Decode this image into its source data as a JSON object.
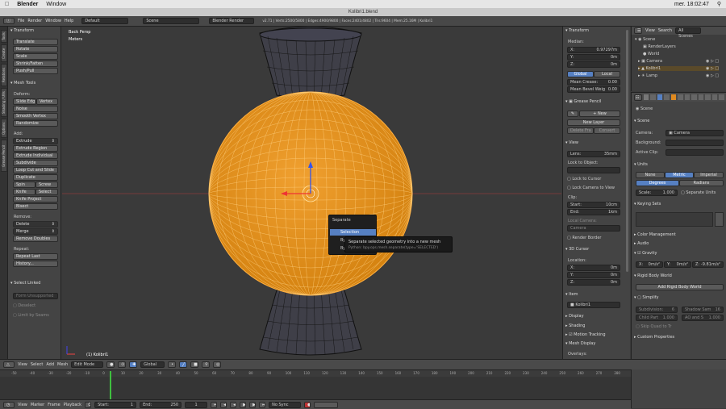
{
  "mac_menu": {
    "apple": "",
    "app": "Blender",
    "window": "Window",
    "clock": "mer. 18:02:47"
  },
  "window_title": "Kolibri1.blend",
  "top": {
    "menus": [
      "File",
      "Render",
      "Window",
      "Help"
    ],
    "layout": "Default",
    "scene": "Scene",
    "engine": "Blender Render",
    "stats": "v2.71 | Verts:2500/5800 | Edges:4900/9800 | Faces:2401/4802 | Tris:9604 | Mem:25.16M | Kolibri1"
  },
  "left_tabs": [
    "Tools",
    "Create",
    "Relations",
    "Shading / UVs",
    "Options",
    "Grease Pencil"
  ],
  "tools": {
    "transform_header": "Transform",
    "transform": [
      "Translate",
      "Rotate",
      "Scale",
      "Shrink/Fatten",
      "Push/Pull"
    ],
    "mesh_tools_header": "Mesh Tools",
    "deform_label": "Deform:",
    "slide_edge": "Slide Edg",
    "vertex": "Vertex",
    "deform": [
      "Noise",
      "Smooth Vertex",
      "Randomize"
    ],
    "add_label": "Add:",
    "extrude": "Extrude",
    "add": [
      "Extrude Region",
      "Extrude Individual",
      "Subdivide",
      "Loop Cut and Slide",
      "Duplicate"
    ],
    "spin": "Spin",
    "screw": "Screw",
    "knife": "Knife",
    "select": "Select",
    "add2": [
      "Knife Project",
      "Bisect"
    ],
    "remove_label": "Remove:",
    "delete": "Delete",
    "merge": "Merge",
    "remove_doubles": "Remove Doubles",
    "repeat_label": "Repeat:",
    "repeat_last": "Repeat Last",
    "history": "History...",
    "select_linked_header": "Select Linked",
    "select_linked_field": "Form Unsupported",
    "deselect": "Deselect",
    "limit_by_seams": "Limit by Seams"
  },
  "viewport": {
    "view_name": "Back Persp",
    "units": "Meters",
    "object_label": "(1) Kolibri1",
    "popup": {
      "title": "Separate",
      "selected": "Selection",
      "by1": "By",
      "by2": "By",
      "tooltip": "Separate selected geometry into a new mesh",
      "python": "Python: bpy.ops.mesh.separate(type='SELECTED')"
    }
  },
  "npanel": {
    "transform_header": "Transform",
    "median_label": "Median:",
    "x": "X:",
    "x_val": "0.97297m",
    "y": "Y:",
    "y_val": "0m",
    "z": "Z:",
    "z_val": "0m",
    "global": "Global",
    "local": "Local",
    "mean_crease": "Mean Crease:",
    "mean_crease_val": "0.00",
    "mean_bevel": "Mean Bevel Weig",
    "mean_bevel_val": "0.00",
    "grease_header": "Grease Pencil",
    "new": "New",
    "new_layer": "New Layer",
    "delete_fra": "Delete Fra",
    "convert": "Convert",
    "view_header": "View",
    "lens": "Lens:",
    "lens_val": "35mm",
    "lock_to_object": "Lock to Object:",
    "lock_to_cursor": "Lock to Cursor",
    "lock_camera_to_view": "Lock Camera to View",
    "clip_label": "Clip:",
    "start": "Start:",
    "start_val": "10cm",
    "end": "End:",
    "end_val": "1km",
    "local_camera": "Local Camera:",
    "camera": "Camera",
    "render_border": "Render Border",
    "cursor_header": "3D Cursor",
    "location": "Location:",
    "cx": "X:",
    "cx_val": "0m",
    "cy": "Y:",
    "cy_val": "0m",
    "cz": "Z:",
    "cz_val": "0m",
    "item_header": "Item",
    "item_val": "Kolibri1",
    "display": "Display",
    "shading": "Shading",
    "motion_tracking": "Motion Tracking",
    "mesh_display": "Mesh Display",
    "overlays": "Overlays:"
  },
  "outliner": {
    "view": "View",
    "search": "Search",
    "all_scenes": "All Scenes",
    "items": [
      "Scene",
      "RenderLayers",
      "World",
      "Camera",
      "Kolibri1",
      "Lamp"
    ]
  },
  "properties": {
    "scene_label": "Scene",
    "scene_header": "Scene",
    "camera_label": "Camera:",
    "camera_val": "Camera",
    "background": "Background:",
    "active_clip": "Active Clip:",
    "units_header": "Units",
    "none": "None",
    "metric": "Metric",
    "imperial": "Imperial",
    "degrees": "Degrees",
    "radians": "Radians",
    "scale": "Scale:",
    "scale_val": "1.000",
    "separate_units": "Separate Units",
    "keying_header": "Keying Sets",
    "color_mgmt": "Color Management",
    "audio": "Audio",
    "gravity": "Gravity",
    "gx": "X:",
    "gx_val": "0m/s²",
    "gy": "Y:",
    "gy_val": "0m/s²",
    "gz": "Z:",
    "gz_val": "-9.81m/s²",
    "rigid_header": "Rigid Body World",
    "add_rigid": "Add Rigid Body World",
    "simplify": "Simplify",
    "subdivision": "Subdivision:",
    "subdivision_val": "6",
    "shadow_samples": "Shadow Sam",
    "shadow_samples_val": "16",
    "child_part": "Child Part",
    "child_part_val": "1.000",
    "ao_and_s": "AO and S",
    "ao_and_s_val": "1.000",
    "skip_quad": "Skip Quad to Tr",
    "custom_props": "Custom Properties"
  },
  "vp_header": {
    "menus": [
      "View",
      "Select",
      "Add",
      "Mesh"
    ],
    "mode": "Edit Mode",
    "orientation": "Global"
  },
  "timeline": {
    "ticks": [
      "-50",
      "-40",
      "-30",
      "-20",
      "-10",
      "0",
      "10",
      "20",
      "30",
      "40",
      "50",
      "60",
      "70",
      "80",
      "90",
      "100",
      "110",
      "120",
      "130",
      "140",
      "150",
      "160",
      "170",
      "180",
      "190",
      "200",
      "210",
      "220",
      "230",
      "240",
      "250",
      "260",
      "270",
      "280"
    ],
    "menus": [
      "View",
      "Marker",
      "Frame",
      "Playback"
    ],
    "start_label": "Start:",
    "start_val": "1",
    "end_label": "End:",
    "end_val": "250",
    "current": "1",
    "sync": "No Sync"
  }
}
